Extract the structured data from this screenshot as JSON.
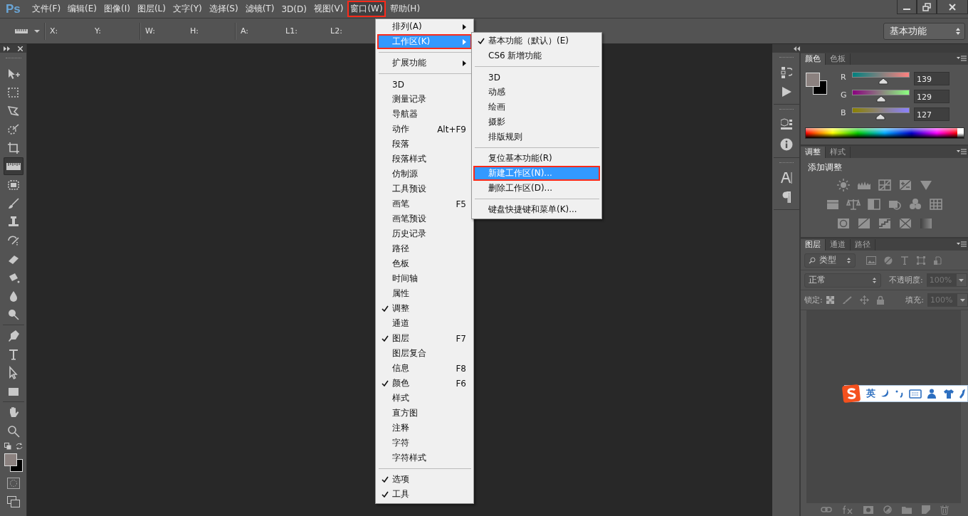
{
  "menubar": {
    "logo": "Ps",
    "items": [
      {
        "label": "文件(F)",
        "selected": false,
        "annotated": false
      },
      {
        "label": "编辑(E)",
        "selected": false,
        "annotated": false
      },
      {
        "label": "图像(I)",
        "selected": false,
        "annotated": false
      },
      {
        "label": "图层(L)",
        "selected": false,
        "annotated": false
      },
      {
        "label": "文字(Y)",
        "selected": false,
        "annotated": false
      },
      {
        "label": "选择(S)",
        "selected": false,
        "annotated": false
      },
      {
        "label": "滤镜(T)",
        "selected": false,
        "annotated": false
      },
      {
        "label": "3D(D)",
        "selected": false,
        "annotated": false
      },
      {
        "label": "视图(V)",
        "selected": false,
        "annotated": false
      },
      {
        "label": "窗口(W)",
        "selected": true,
        "annotated": true
      },
      {
        "label": "帮助(H)",
        "selected": false,
        "annotated": false
      }
    ]
  },
  "options_bar": {
    "groups": [
      [
        "X:",
        "Y:"
      ],
      [
        "W:",
        "H:"
      ],
      [
        "A:",
        "L1:",
        "L2:"
      ]
    ],
    "workspace": "基本功能"
  },
  "toolbar": {
    "groups": [
      [
        {
          "kind": "move",
          "selected": false
        },
        {
          "kind": "marquee",
          "selected": false
        },
        {
          "kind": "lasso",
          "selected": false
        },
        {
          "kind": "quick-select",
          "selected": false
        },
        {
          "kind": "crop",
          "selected": false
        },
        {
          "kind": "ruler",
          "selected": true
        },
        {
          "kind": "healing",
          "selected": false
        },
        {
          "kind": "brush",
          "selected": false
        },
        {
          "kind": "stamp",
          "selected": false
        },
        {
          "kind": "history-brush",
          "selected": false
        },
        {
          "kind": "eraser",
          "selected": false
        },
        {
          "kind": "bucket",
          "selected": false
        },
        {
          "kind": "blur",
          "selected": false
        },
        {
          "kind": "dodge",
          "selected": false
        }
      ],
      [
        {
          "kind": "pen",
          "selected": false
        },
        {
          "kind": "type",
          "selected": false
        },
        {
          "kind": "path-select",
          "selected": false
        },
        {
          "kind": "rectangle",
          "selected": false
        }
      ],
      [
        {
          "kind": "hand",
          "selected": false
        },
        {
          "kind": "zoom",
          "selected": false
        }
      ]
    ],
    "swatches": [
      {
        "color": "#8b817f"
      },
      {
        "color": "#000000"
      }
    ]
  },
  "window_menu": {
    "items": [
      {
        "kind": "item",
        "label": "排列(A)",
        "submenu": true,
        "checked": false,
        "selected": false,
        "annotated": false
      },
      {
        "kind": "item",
        "label": "工作区(K)",
        "submenu": true,
        "checked": false,
        "selected": true,
        "annotated": true
      },
      {
        "kind": "separator"
      },
      {
        "kind": "item",
        "label": "扩展功能",
        "submenu": true,
        "checked": false,
        "selected": false,
        "annotated": false
      },
      {
        "kind": "separator"
      },
      {
        "kind": "item",
        "label": "3D",
        "submenu": false,
        "checked": false,
        "selected": false,
        "annotated": false
      },
      {
        "kind": "item",
        "label": "测量记录",
        "submenu": false,
        "checked": false,
        "selected": false,
        "annotated": false
      },
      {
        "kind": "item",
        "label": "导航器",
        "submenu": false,
        "checked": false,
        "selected": false,
        "annotated": false
      },
      {
        "kind": "item",
        "label": "动作",
        "shortcut": "Alt+F9",
        "submenu": false,
        "checked": false,
        "selected": false,
        "annotated": false
      },
      {
        "kind": "item",
        "label": "段落",
        "submenu": false,
        "checked": false,
        "selected": false,
        "annotated": false
      },
      {
        "kind": "item",
        "label": "段落样式",
        "submenu": false,
        "checked": false,
        "selected": false,
        "annotated": false
      },
      {
        "kind": "item",
        "label": "仿制源",
        "submenu": false,
        "checked": false,
        "selected": false,
        "annotated": false
      },
      {
        "kind": "item",
        "label": "工具预设",
        "submenu": false,
        "checked": false,
        "selected": false,
        "annotated": false
      },
      {
        "kind": "item",
        "label": "画笔",
        "shortcut": "F5",
        "submenu": false,
        "checked": false,
        "selected": false,
        "annotated": false
      },
      {
        "kind": "item",
        "label": "画笔预设",
        "submenu": false,
        "checked": false,
        "selected": false,
        "annotated": false
      },
      {
        "kind": "item",
        "label": "历史记录",
        "submenu": false,
        "checked": false,
        "selected": false,
        "annotated": false
      },
      {
        "kind": "item",
        "label": "路径",
        "submenu": false,
        "checked": false,
        "selected": false,
        "annotated": false
      },
      {
        "kind": "item",
        "label": "色板",
        "submenu": false,
        "checked": false,
        "selected": false,
        "annotated": false
      },
      {
        "kind": "item",
        "label": "时间轴",
        "submenu": false,
        "checked": false,
        "selected": false,
        "annotated": false
      },
      {
        "kind": "item",
        "label": "属性",
        "submenu": false,
        "checked": false,
        "selected": false,
        "annotated": false
      },
      {
        "kind": "item",
        "label": "调整",
        "submenu": false,
        "checked": true,
        "selected": false,
        "annotated": false
      },
      {
        "kind": "item",
        "label": "通道",
        "submenu": false,
        "checked": false,
        "selected": false,
        "annotated": false
      },
      {
        "kind": "item",
        "label": "图层",
        "shortcut": "F7",
        "submenu": false,
        "checked": true,
        "selected": false,
        "annotated": false
      },
      {
        "kind": "item",
        "label": "图层复合",
        "submenu": false,
        "checked": false,
        "selected": false,
        "annotated": false
      },
      {
        "kind": "item",
        "label": "信息",
        "shortcut": "F8",
        "submenu": false,
        "checked": false,
        "selected": false,
        "annotated": false
      },
      {
        "kind": "item",
        "label": "颜色",
        "shortcut": "F6",
        "submenu": false,
        "checked": true,
        "selected": false,
        "annotated": false
      },
      {
        "kind": "item",
        "label": "样式",
        "submenu": false,
        "checked": false,
        "selected": false,
        "annotated": false
      },
      {
        "kind": "item",
        "label": "直方图",
        "submenu": false,
        "checked": false,
        "selected": false,
        "annotated": false
      },
      {
        "kind": "item",
        "label": "注释",
        "submenu": false,
        "checked": false,
        "selected": false,
        "annotated": false
      },
      {
        "kind": "item",
        "label": "字符",
        "submenu": false,
        "checked": false,
        "selected": false,
        "annotated": false
      },
      {
        "kind": "item",
        "label": "字符样式",
        "submenu": false,
        "checked": false,
        "selected": false,
        "annotated": false
      },
      {
        "kind": "separator"
      },
      {
        "kind": "item",
        "label": "选项",
        "submenu": false,
        "checked": true,
        "selected": false,
        "annotated": false
      },
      {
        "kind": "item",
        "label": "工具",
        "submenu": false,
        "checked": true,
        "selected": false,
        "annotated": false
      }
    ]
  },
  "workspace_submenu": {
    "items": [
      {
        "kind": "item",
        "label": "基本功能（默认）(E)",
        "checked": true,
        "selected": false,
        "annotated": false
      },
      {
        "kind": "item",
        "label": "CS6 新增功能",
        "checked": false,
        "selected": false,
        "annotated": false
      },
      {
        "kind": "separator"
      },
      {
        "kind": "item",
        "label": "3D",
        "checked": false,
        "selected": false,
        "annotated": false
      },
      {
        "kind": "item",
        "label": "动感",
        "checked": false,
        "selected": false,
        "annotated": false
      },
      {
        "kind": "item",
        "label": "绘画",
        "checked": false,
        "selected": false,
        "annotated": false
      },
      {
        "kind": "item",
        "label": "摄影",
        "checked": false,
        "selected": false,
        "annotated": false
      },
      {
        "kind": "item",
        "label": "排版规则",
        "checked": false,
        "selected": false,
        "annotated": false
      },
      {
        "kind": "separator"
      },
      {
        "kind": "item",
        "label": "复位基本功能(R)",
        "checked": false,
        "selected": false,
        "annotated": false
      },
      {
        "kind": "item",
        "label": "新建工作区(N)...",
        "checked": false,
        "selected": true,
        "annotated": true
      },
      {
        "kind": "item",
        "label": "删除工作区(D)...",
        "checked": false,
        "selected": false,
        "annotated": false
      },
      {
        "kind": "separator"
      },
      {
        "kind": "item",
        "label": "键盘快捷键和菜单(K)...",
        "checked": false,
        "selected": false,
        "annotated": false
      }
    ]
  },
  "color_panel": {
    "tabs": [
      {
        "label": "颜色",
        "selected": true
      },
      {
        "label": "色板",
        "selected": false
      }
    ],
    "swatches": [
      {
        "color": "#8b817f"
      },
      {
        "color": "#000000"
      }
    ],
    "channels": [
      {
        "name": "R",
        "level": 0.545,
        "value": "139"
      },
      {
        "name": "G",
        "level": 0.506,
        "value": "129"
      },
      {
        "name": "B",
        "level": 0.498,
        "value": "127"
      }
    ]
  },
  "adjustments_panel": {
    "tabs": [
      {
        "label": "调整",
        "selected": true
      },
      {
        "label": "样式",
        "selected": false
      }
    ],
    "title": "添加调整"
  },
  "layers_panel": {
    "tabs": [
      {
        "label": "图层",
        "selected": true
      },
      {
        "label": "通道",
        "selected": false
      },
      {
        "label": "路径",
        "selected": false
      }
    ],
    "filter": "类型",
    "blend_mode": "正常",
    "opacity": {
      "label": "不透明度:",
      "value": "100%",
      "disabled": true
    },
    "lock_label": "锁定:",
    "fill": {
      "label": "填充:",
      "value": "100%",
      "disabled": true
    }
  },
  "ime_bar": {
    "mode": "英"
  }
}
